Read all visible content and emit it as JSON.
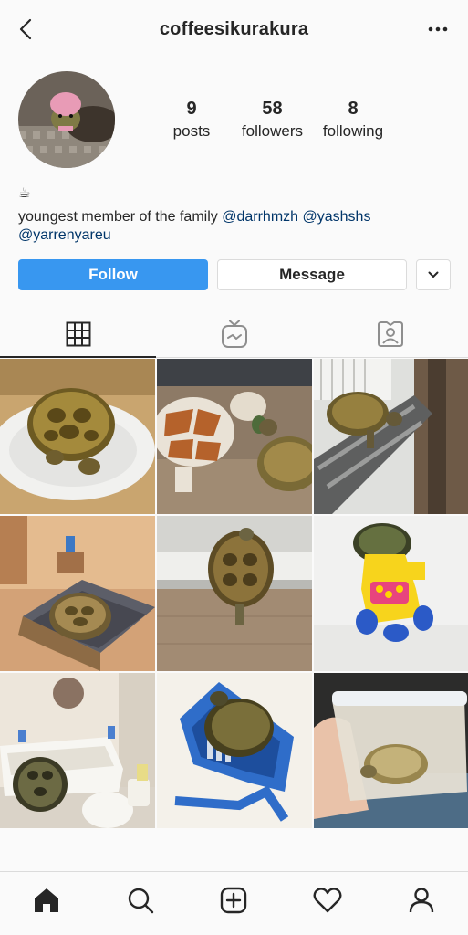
{
  "header": {
    "username": "coffeesikurakura",
    "back_icon": "chevron-left-icon",
    "more_icon": "more-horizontal-icon"
  },
  "profile": {
    "stats": [
      {
        "value": "9",
        "label": "posts"
      },
      {
        "value": "58",
        "label": "followers"
      },
      {
        "value": "8",
        "label": "following"
      }
    ],
    "bio_emoji": "☕",
    "bio_text": "youngest member of the family ",
    "mentions": [
      "@darrhmzh",
      "@yashshs",
      "@yarrenyareu"
    ]
  },
  "actions": {
    "follow_label": "Follow",
    "message_label": "Message",
    "dropdown_icon": "chevron-down-icon"
  },
  "tabs": [
    {
      "name": "grid",
      "icon": "grid-icon",
      "active": true
    },
    {
      "name": "igtv",
      "icon": "igtv-icon",
      "active": false
    },
    {
      "name": "tagged",
      "icon": "tagged-icon",
      "active": false
    }
  ],
  "posts": [
    {
      "subject": "tortoise on white plate"
    },
    {
      "subject": "tortoise with plush giraffe"
    },
    {
      "subject": "tortoise at window sill"
    },
    {
      "subject": "tortoise on miniature bed"
    },
    {
      "subject": "tortoise near window"
    },
    {
      "subject": "turtle on toy car"
    },
    {
      "subject": "tortoise in miniature bathroom"
    },
    {
      "subject": "turtle on blue basket"
    },
    {
      "subject": "tortoise in plastic container"
    }
  ],
  "bottom_nav": [
    {
      "name": "home",
      "icon": "home-icon",
      "active": true
    },
    {
      "name": "search",
      "icon": "search-icon",
      "active": false
    },
    {
      "name": "new-post",
      "icon": "plus-square-icon",
      "active": false
    },
    {
      "name": "activity",
      "icon": "heart-icon",
      "active": false
    },
    {
      "name": "profile",
      "icon": "person-icon",
      "active": false
    }
  ],
  "colors": {
    "accent": "#3897f0",
    "mention": "#003569",
    "text": "#262626",
    "border": "#dbdbdb"
  }
}
